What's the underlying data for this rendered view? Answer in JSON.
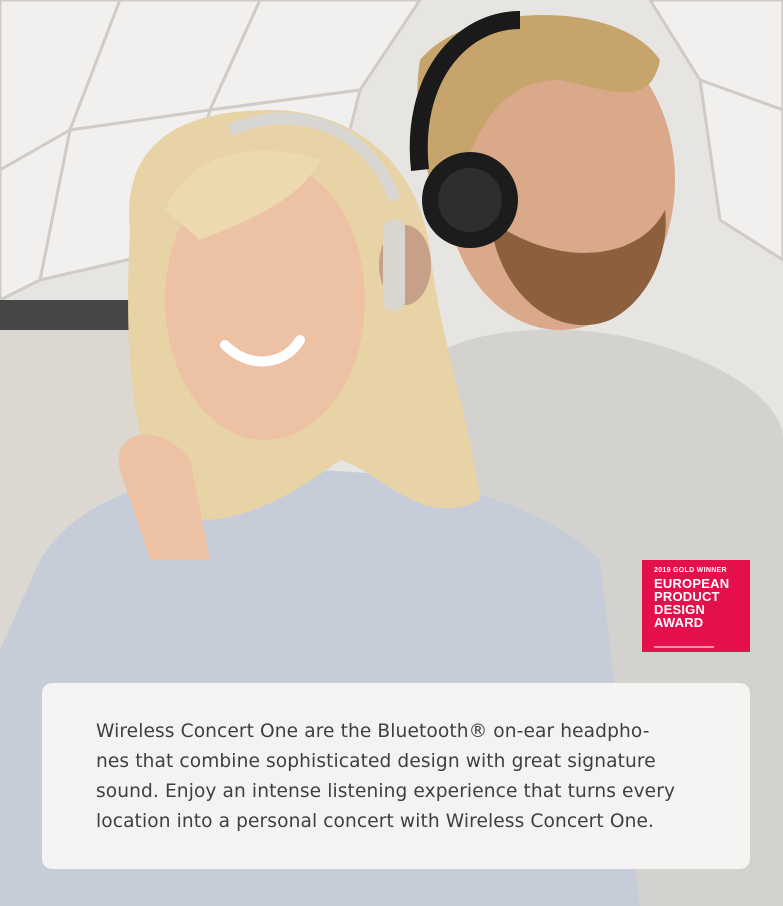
{
  "award": {
    "kicker": "2019 GOLD WINNER",
    "lines": [
      "EUROPEAN",
      "PRODUCT",
      "DESIGN",
      "AWARD"
    ]
  },
  "caption": {
    "lines": [
      "Wireless Concert One are the Bluetooth® on-ear headpho-",
      "nes that combine sophisticated design with great signature",
      "sound. Enjoy an intense listening experience that turns every",
      "location into a personal concert with Wireless Concert One."
    ]
  },
  "colors": {
    "award_red": "#e4104c",
    "caption_text": "#3f3f3f",
    "card_background": "#f8f7f6"
  }
}
